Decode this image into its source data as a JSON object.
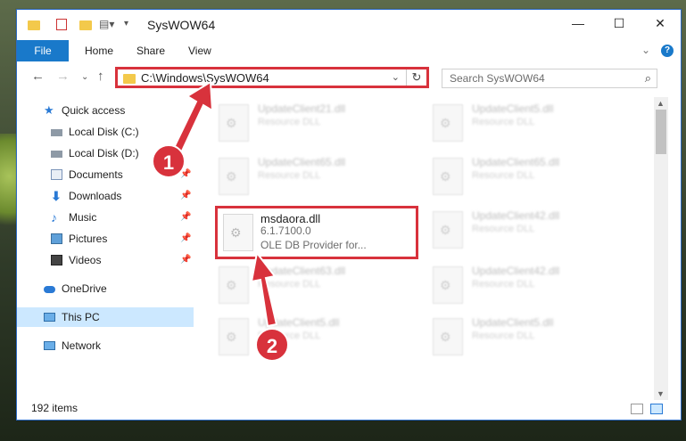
{
  "window": {
    "title": "SysWOW64",
    "minimize_glyph": "—",
    "maximize_glyph": "☐",
    "close_glyph": "✕"
  },
  "ribbon": {
    "tabs": [
      "File",
      "Home",
      "Share",
      "View"
    ],
    "help_glyph": "?"
  },
  "nav": {
    "address_path": "C:\\Windows\\SysWOW64",
    "search_placeholder": "Search SysWOW64"
  },
  "sidebar": {
    "items": [
      {
        "label": "Quick access",
        "icon": "star-icon"
      },
      {
        "label": "Local Disk (C:)",
        "icon": "drive-icon"
      },
      {
        "label": "Local Disk (D:)",
        "icon": "drive-icon"
      },
      {
        "label": "Documents",
        "icon": "documents-icon"
      },
      {
        "label": "Downloads",
        "icon": "download-icon"
      },
      {
        "label": "Music",
        "icon": "music-icon"
      },
      {
        "label": "Pictures",
        "icon": "pictures-icon"
      },
      {
        "label": "Videos",
        "icon": "videos-icon"
      },
      {
        "label": "OneDrive",
        "icon": "cloud-icon"
      },
      {
        "label": "This PC",
        "icon": "computer-icon"
      },
      {
        "label": "Network",
        "icon": "network-icon"
      }
    ],
    "selected": "This PC"
  },
  "files": {
    "left_column": [
      {
        "name": "UpdateClient21.dll",
        "desc": "Resource DLL"
      },
      {
        "name": "UpdateClient65.dll",
        "desc": "Resource DLL"
      },
      {
        "name": "msdaora.dll",
        "version": "6.1.7100.0",
        "desc": "OLE DB Provider for..."
      },
      {
        "name": "UpdateClient63.dll",
        "desc": "Resource DLL"
      },
      {
        "name": "UpdateClient5.dll",
        "desc": "Resource DLL"
      }
    ],
    "right_column": [
      {
        "name": "UpdateClient5.dll",
        "desc": "Resource DLL"
      },
      {
        "name": "UpdateClient65.dll",
        "desc": "Resource DLL"
      },
      {
        "name": "UpdateClient42.dll",
        "desc": "Resource DLL"
      },
      {
        "name": "UpdateClient42.dll",
        "desc": "Resource DLL"
      },
      {
        "name": "UpdateClient5.dll",
        "desc": "Resource DLL"
      }
    ]
  },
  "status": {
    "item_count": "192 items"
  },
  "annotations": {
    "step1": "1",
    "step2": "2",
    "color": "#d8323c"
  }
}
